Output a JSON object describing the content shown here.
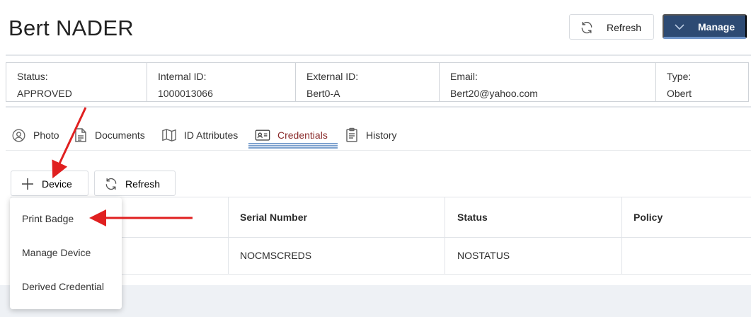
{
  "header": {
    "title": "Bert NADER",
    "refresh_label": "Refresh",
    "manage_label": "Manage"
  },
  "info": {
    "status": {
      "label": "Status:",
      "value": "APPROVED"
    },
    "internal_id": {
      "label": "Internal ID:",
      "value": "1000013066"
    },
    "external_id": {
      "label": "External ID:",
      "value": "Bert0-A"
    },
    "email": {
      "label": "Email:",
      "value": "Bert20@yahoo.com"
    },
    "type": {
      "label": "Type:",
      "value": "Obert"
    }
  },
  "tabs": [
    {
      "label": "Photo",
      "icon": "user-circle-icon"
    },
    {
      "label": "Documents",
      "icon": "document-icon"
    },
    {
      "label": "ID Attributes",
      "icon": "map-icon"
    },
    {
      "label": "Credentials",
      "icon": "id-card-icon",
      "active": true
    },
    {
      "label": "History",
      "icon": "clipboard-icon"
    }
  ],
  "toolbar": {
    "device_label": "Device",
    "refresh_label": "Refresh"
  },
  "table": {
    "headers": [
      "Serial Number",
      "Status",
      "Policy"
    ],
    "rows": [
      [
        "NOCMSCREDS",
        "NOSTATUS",
        ""
      ]
    ]
  },
  "device_menu": {
    "items": [
      "Print Badge",
      "Manage Device",
      "Derived Credential"
    ]
  },
  "colors": {
    "manage_bg": "#2d4a73",
    "active_tab": "#8a2b2b",
    "annotation_arrow": "#e02020"
  }
}
